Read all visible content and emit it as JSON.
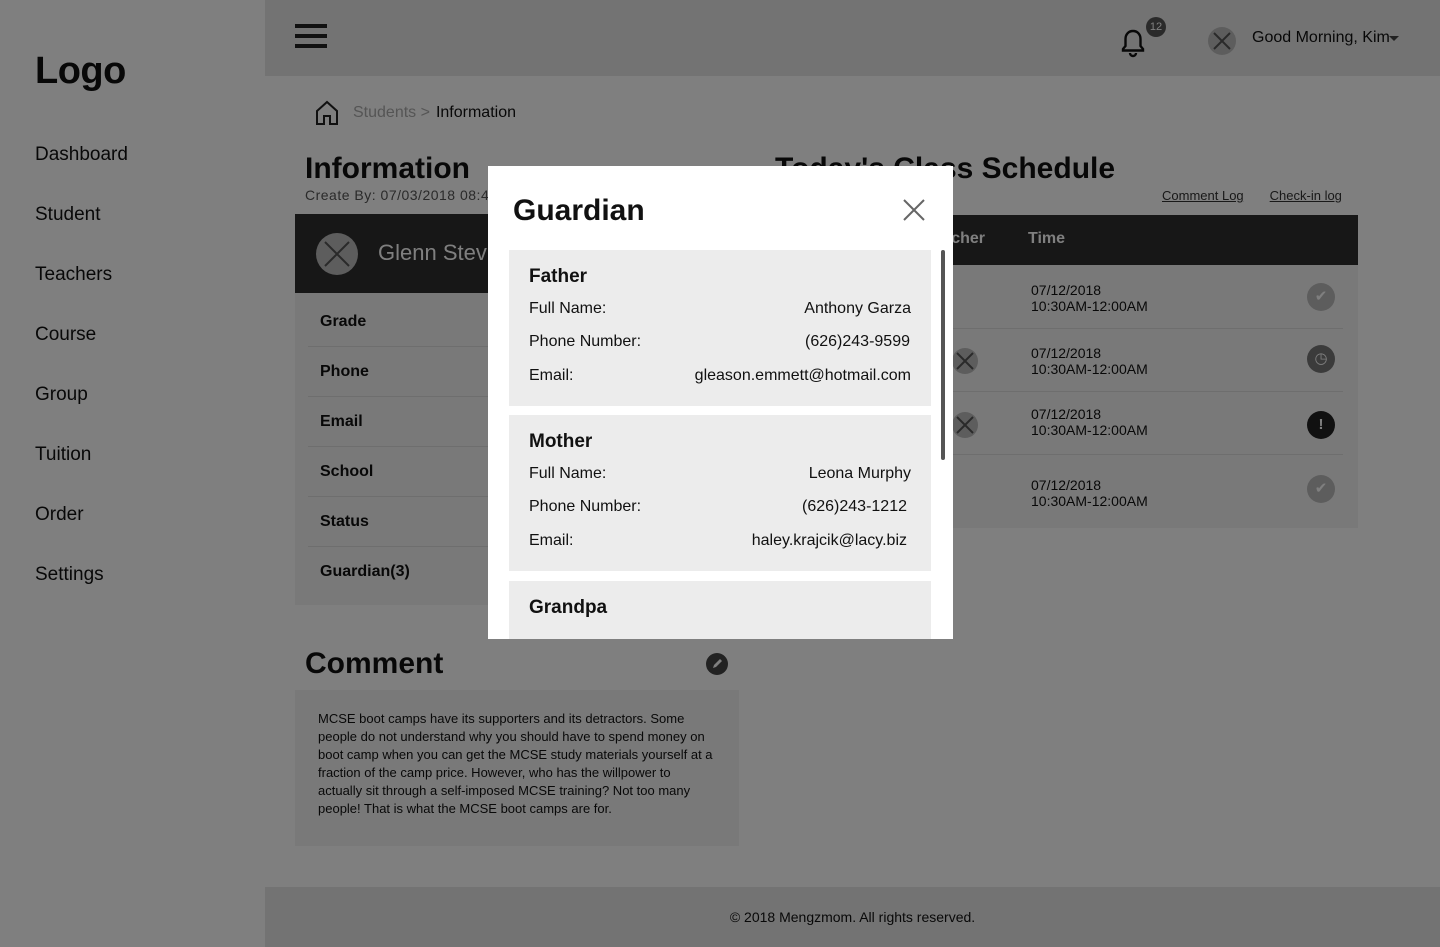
{
  "sidebar": {
    "logo": "Logo",
    "items": [
      "Dashboard",
      "Student",
      "Teachers",
      "Course",
      "Group",
      "Tuition",
      "Order",
      "Settings"
    ]
  },
  "header": {
    "notification_count": "12",
    "greeting": "Good Morning, Kim"
  },
  "breadcrumb": {
    "parent": "Students >",
    "current": "Information"
  },
  "info": {
    "title": "Information",
    "created": "Create By: 07/03/2018  08:4",
    "student_name": "Glenn Stev",
    "fields": [
      "Grade",
      "Phone",
      "Email",
      "School",
      "Status",
      "Guardian(3)"
    ]
  },
  "comment": {
    "title": "Comment",
    "text": "MCSE boot camps have its supporters and its detractors. Some people do not understand why you should have to spend money on boot camp when you can get the MCSE study materials yourself at a fraction of the camp price. However, who has the willpower to actually sit through a self-imposed MCSE training? Not too many people! That is what the MCSE boot camps are for."
  },
  "schedule": {
    "title": "Today's Class Schedule",
    "links": [
      "Comment Log",
      "Check-in log"
    ],
    "columns": [
      "cher",
      "Time"
    ],
    "rows": [
      {
        "date": "07/12/2018",
        "time": "10:30AM-12:00AM",
        "status": "check-icon"
      },
      {
        "date": "07/12/2018",
        "time": "10:30AM-12:00AM",
        "status": "clock-icon"
      },
      {
        "date": "07/12/2018",
        "time": "10:30AM-12:00AM",
        "status": "alert-icon"
      },
      {
        "date": "07/12/2018",
        "time": "10:30AM-12:00AM",
        "status": "check-icon"
      }
    ]
  },
  "modal": {
    "title": "Guardian",
    "guardians": [
      {
        "role": "Father",
        "full_name_label": "Full Name:",
        "full_name": "Anthony Garza",
        "phone_label": "Phone Number:",
        "phone": "(626)243-9599",
        "email_label": "Email:",
        "email": "gleason.emmett@hotmail.com"
      },
      {
        "role": "Mother",
        "full_name_label": "Full Name:",
        "full_name": "Leona Murphy",
        "phone_label": "Phone Number:",
        "phone": "(626)243-1212",
        "email_label": "Email:",
        "email": "haley.krajcik@lacy.biz"
      },
      {
        "role": "Grandpa"
      }
    ]
  },
  "footer": {
    "text": "© 2018 Mengzmom. All rights reserved."
  }
}
